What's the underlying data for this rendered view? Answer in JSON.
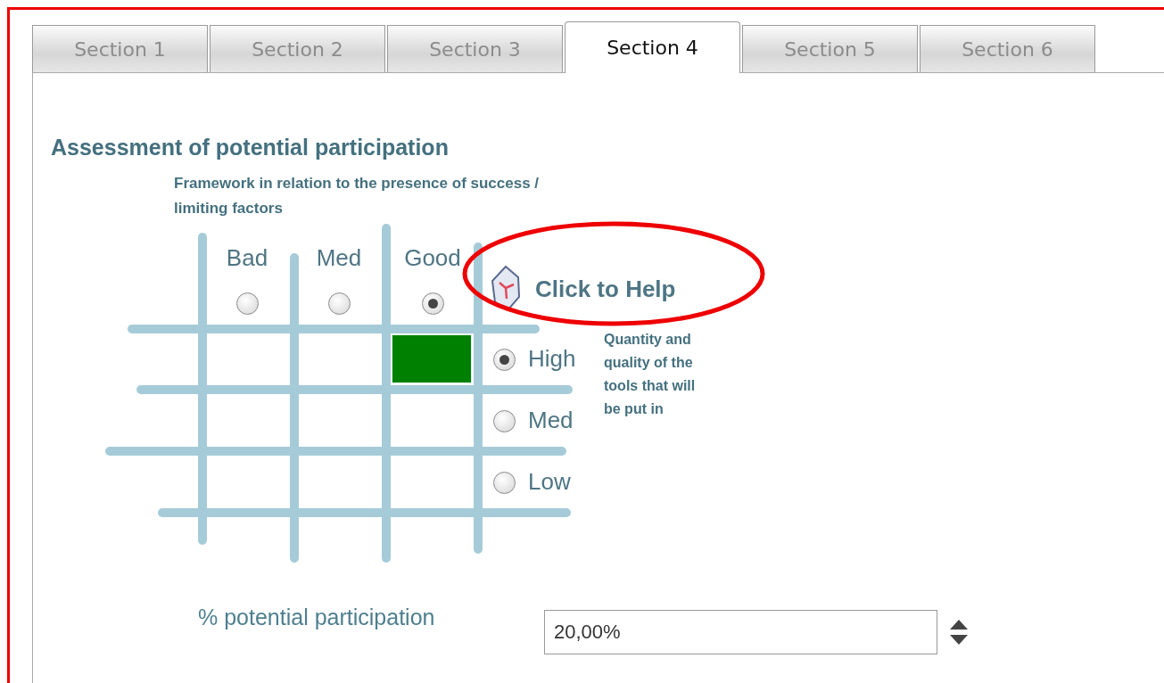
{
  "tabs": [
    {
      "label": "Section 1",
      "selected": false
    },
    {
      "label": "Section 2",
      "selected": false
    },
    {
      "label": "Section 3",
      "selected": false
    },
    {
      "label": "Section 4",
      "selected": true
    },
    {
      "label": "Section 5",
      "selected": false
    },
    {
      "label": "Section 6",
      "selected": false
    }
  ],
  "heading": "Assessment of potential participation",
  "subheading": "Framework in relation to the presence of success / limiting factors",
  "columns": [
    {
      "label": "Bad",
      "selected": false
    },
    {
      "label": "Med",
      "selected": false
    },
    {
      "label": "Good",
      "selected": true
    }
  ],
  "rows": [
    {
      "label": "High",
      "selected": true
    },
    {
      "label": "Med",
      "selected": false
    },
    {
      "label": "Low",
      "selected": false
    }
  ],
  "help_link": "Click to Help",
  "row_axis_label": "Quantity and quality of the tools that will be put in",
  "participation": {
    "label": "% potential participation",
    "value": "20,00%"
  }
}
